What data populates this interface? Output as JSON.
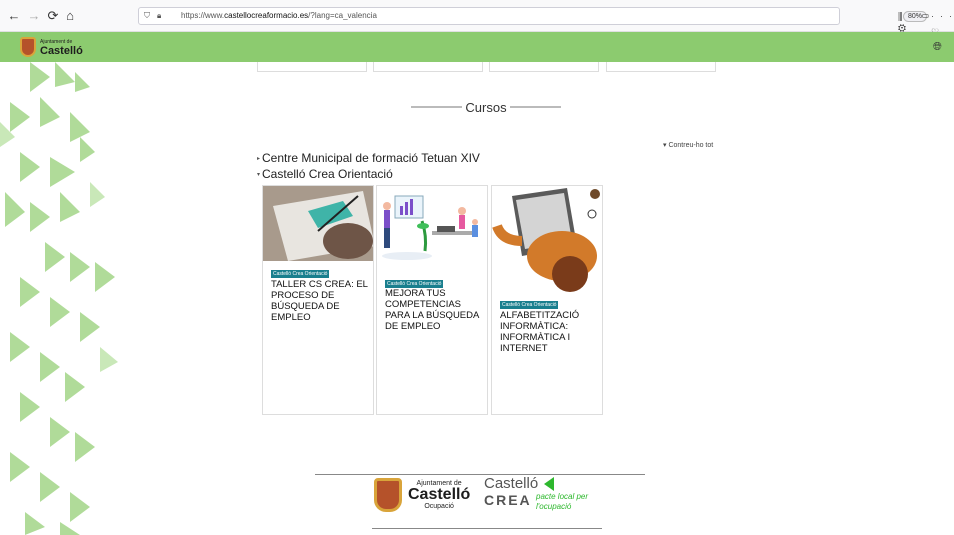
{
  "browser": {
    "url_prefix": "https://www.",
    "url_domain": "castellocreaformacio.es",
    "url_path": "/?lang=ca_valencia",
    "zoom": "80%"
  },
  "header": {
    "logo_small": "Ajuntament de",
    "logo_big": "Castelló"
  },
  "main": {
    "section_title": "Cursos",
    "collapse_all": "Contreu-ho tot",
    "categories": [
      {
        "label": "Centre Municipal de formació Tetuan XIV",
        "expanded": false
      },
      {
        "label": "Castelló Crea Orientació",
        "expanded": true
      }
    ],
    "courses": [
      {
        "badge": "Castelló Crea Orientació",
        "title": "TALLER CS CREA: EL PROCESO DE BÚSQUEDA DE EMPLEO"
      },
      {
        "badge": "Castelló Crea Orientació",
        "title": "MEJORA TUS COMPETENCIAS PARA LA BÚSQUEDA DE EMPLEO"
      },
      {
        "badge": "Castelló Crea Orientació",
        "title": "ALFABETITZACIÓ INFORMÀTICA: INFORMÀTICA I INTERNET"
      }
    ]
  },
  "footer": {
    "logo1_small": "Ajuntament de",
    "logo1_big": "Castelló",
    "logo1_sub": "Ocupació",
    "logo2_line1": "Castelló",
    "logo2_line2": "CREA",
    "logo2_pacte": "pacte local per l'ocupació"
  },
  "colors": {
    "brand_green": "#8ccb6f",
    "badge_teal": "#1a7f8e"
  }
}
